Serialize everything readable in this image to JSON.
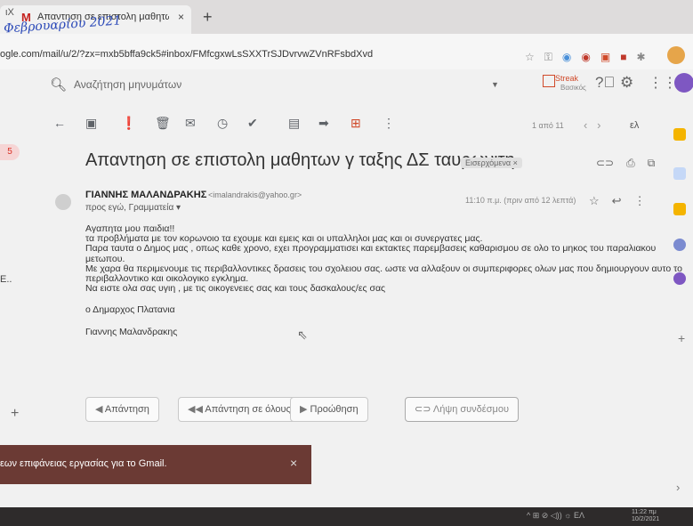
{
  "handwritten_note": "Φεβρουαρίου 2021",
  "browser": {
    "tab_prefix": "ιΧ",
    "tab_title": "Απαντηση σε επιστολη μαθητω",
    "url": "ogle.com/mail/u/2/?zx=mxb5bffa9ck5#inbox/FMfcgxwLsSXXTrSJDvrvwZVnRFsbdXvd",
    "close_glyph": "×",
    "new_tab_glyph": "+"
  },
  "gmail": {
    "search_placeholder": "Αναζήτηση μηνυμάτων",
    "streak_label": "Streak",
    "streak_sub": "Βασικός",
    "pager": "1 από 11",
    "lang": "ελ",
    "left_badge": "5"
  },
  "message": {
    "subject": "Απαντηση σε επιστολη μαθητων γ ταξης ΔΣ ταυρωνιτη",
    "label": "Εισερχόμενα ×",
    "sender": "ΓΙΑΝΝΗΣ ΜΑΛΑΝΔΡΑΚΗΣ",
    "sender_email": "<imalandrakis@yahoo.gr>",
    "recipients": "προς εγώ, Γραμματεία ▾",
    "time": "11:10 π.μ. (πριν από 12 λεπτά)",
    "body": [
      "Αγαπητα μου παιδια!!",
      "τα προβλήματα με τον κορωνοιο τα εχουμε και εμεις και οι υπαλληλοι μας και οι συνεργατες μας.",
      "Παρα ταυτα ο Δημος μας , οπως καθε χρονο,  εχει προγραμματισει και εκτακτες παρεμβασεις καθαρισμου σε ολο το μηκος του παραλιακου",
      "μετωπου.",
      "Με χαρα θα περιμενουμε τις περιβαλλοντικες δρασεις του σχολειου σας. ωστε να αλλαξουν οι συμπεριφορες ολων μας που δημιουργουν αυτο το",
      "περιβαλλοντικο και οικολογικο εγκλημα.",
      "Να ειστε ολα σας υγιη , με τις οικογενειες σας και τους δασκαλους/ες σας",
      "",
      "ο Δημαρχος Πλατανια",
      "",
      "Γιαννης Μαλανδρακης"
    ]
  },
  "actions": {
    "reply": "Απάντηση",
    "reply_all": "Απάντηση σε όλους",
    "forward": "Προώθηση",
    "get_link": "Λήψη συνδέσμου"
  },
  "snackbar": {
    "text": "εων επιφάνειας εργασίας για το Gmail.",
    "close": "×"
  },
  "left_edge_text": "E..",
  "taskbar": {
    "tray": "^  ⊞  ⊘  ◁))  ☼  ΕΛ",
    "time": "11:22 πμ",
    "date": "10/2/2021"
  },
  "colors": {
    "accent_red": "#d93025",
    "snackbar": "#6b3a34",
    "account": "#7e57c2"
  }
}
